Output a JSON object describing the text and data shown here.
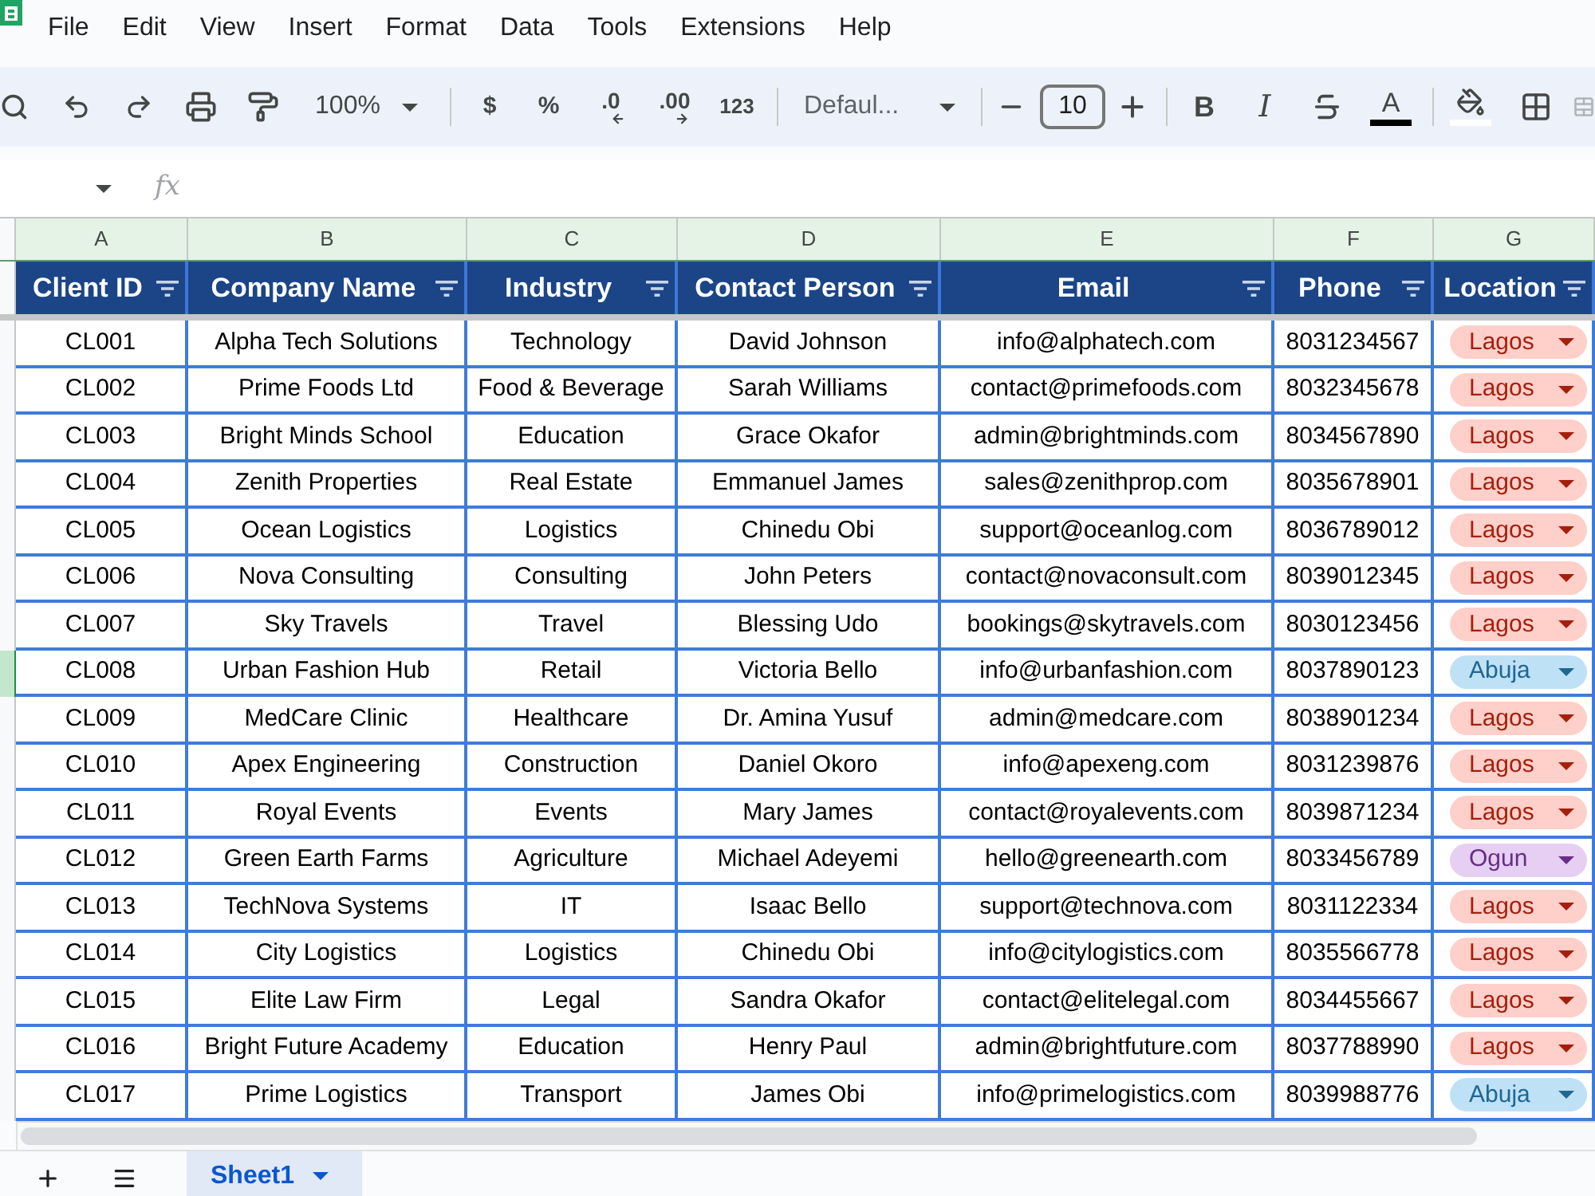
{
  "menu_bar": {
    "items": [
      "File",
      "Edit",
      "View",
      "Insert",
      "Format",
      "Data",
      "Tools",
      "Extensions",
      "Help"
    ]
  },
  "toolbar": {
    "zoom": "100%",
    "currency": "$",
    "percent": "%",
    "decrease_decimal": ".0",
    "increase_decimal": ".00",
    "number_format": "123",
    "font": "Defaul...",
    "font_size": "10",
    "bold": "B",
    "italic": "I",
    "text_color": "A"
  },
  "formula_bar": {
    "fx": "fx"
  },
  "sheet": {
    "column_letters": [
      "A",
      "B",
      "C",
      "D",
      "E",
      "F",
      "G"
    ],
    "headers": [
      "Client ID",
      "Company Name",
      "Industry",
      "Contact Person",
      "Email",
      "Phone",
      "Location"
    ],
    "rows": [
      {
        "selected": false,
        "cells": [
          "CL001",
          "Alpha Tech Solutions",
          "Technology",
          "David Johnson",
          "info@alphatech.com",
          "8031234567"
        ],
        "location": {
          "label": "Lagos",
          "color": "#ffcfc9"
        }
      },
      {
        "selected": false,
        "cells": [
          "CL002",
          "Prime Foods Ltd",
          "Food & Beverage",
          "Sarah Williams",
          "contact@primefoods.com",
          "8032345678"
        ],
        "location": {
          "label": "Lagos",
          "color": "#ffcfc9"
        }
      },
      {
        "selected": false,
        "cells": [
          "CL003",
          "Bright Minds School",
          "Education",
          "Grace Okafor",
          "admin@brightminds.com",
          "8034567890"
        ],
        "location": {
          "label": "Lagos",
          "color": "#ffcfc9"
        }
      },
      {
        "selected": false,
        "cells": [
          "CL004",
          "Zenith Properties",
          "Real Estate",
          "Emmanuel James",
          "sales@zenithprop.com",
          "8035678901"
        ],
        "location": {
          "label": "Lagos",
          "color": "#ffcfc9"
        }
      },
      {
        "selected": false,
        "cells": [
          "CL005",
          "Ocean Logistics",
          "Logistics",
          "Chinedu Obi",
          "support@oceanlog.com",
          "8036789012"
        ],
        "location": {
          "label": "Lagos",
          "color": "#ffcfc9"
        }
      },
      {
        "selected": false,
        "cells": [
          "CL006",
          "Nova Consulting",
          "Consulting",
          "John Peters",
          "contact@novaconsult.com",
          "8039012345"
        ],
        "location": {
          "label": "Lagos",
          "color": "#ffcfc9"
        }
      },
      {
        "selected": false,
        "cells": [
          "CL007",
          "Sky Travels",
          "Travel",
          "Blessing Udo",
          "bookings@skytravels.com",
          "8030123456"
        ],
        "location": {
          "label": "Lagos",
          "color": "#ffcfc9"
        }
      },
      {
        "selected": true,
        "cells": [
          "CL008",
          "Urban Fashion Hub",
          "Retail",
          "Victoria Bello",
          "info@urbanfashion.com",
          "8037890123"
        ],
        "location": {
          "label": "Abuja",
          "color": "#bfe1f6"
        }
      },
      {
        "selected": false,
        "cells": [
          "CL009",
          "MedCare Clinic",
          "Healthcare",
          "Dr. Amina Yusuf",
          "admin@medcare.com",
          "8038901234"
        ],
        "location": {
          "label": "Lagos",
          "color": "#ffcfc9"
        }
      },
      {
        "selected": false,
        "cells": [
          "CL010",
          "Apex Engineering",
          "Construction",
          "Daniel Okoro",
          "info@apexeng.com",
          "8031239876"
        ],
        "location": {
          "label": "Lagos",
          "color": "#ffcfc9"
        }
      },
      {
        "selected": false,
        "cells": [
          "CL011",
          "Royal Events",
          "Events",
          "Mary James",
          "contact@royalevents.com",
          "8039871234"
        ],
        "location": {
          "label": "Lagos",
          "color": "#ffcfc9"
        }
      },
      {
        "selected": false,
        "cells": [
          "CL012",
          "Green Earth Farms",
          "Agriculture",
          "Michael Adeyemi",
          "hello@greenearth.com",
          "8033456789"
        ],
        "location": {
          "label": "Ogun",
          "color": "#e6cff2"
        }
      },
      {
        "selected": false,
        "cells": [
          "CL013",
          "TechNova Systems",
          "IT",
          "Isaac Bello",
          "support@technova.com",
          "8031122334"
        ],
        "location": {
          "label": "Lagos",
          "color": "#ffcfc9"
        }
      },
      {
        "selected": false,
        "cells": [
          "CL014",
          "City Logistics",
          "Logistics",
          "Chinedu Obi",
          "info@citylogistics.com",
          "8035566778"
        ],
        "location": {
          "label": "Lagos",
          "color": "#ffcfc9"
        }
      },
      {
        "selected": false,
        "cells": [
          "CL015",
          "Elite Law Firm",
          "Legal",
          "Sandra Okafor",
          "contact@elitelegal.com",
          "8034455667"
        ],
        "location": {
          "label": "Lagos",
          "color": "#ffcfc9"
        }
      },
      {
        "selected": false,
        "cells": [
          "CL016",
          "Bright Future Academy",
          "Education",
          "Henry Paul",
          "admin@brightfuture.com",
          "8037788990"
        ],
        "location": {
          "label": "Lagos",
          "color": "#ffcfc9"
        }
      },
      {
        "selected": false,
        "cells": [
          "CL017",
          "Prime Logistics",
          "Transport",
          "James Obi",
          "info@primelogistics.com",
          "8039988776"
        ],
        "location": {
          "label": "Abuja",
          "color": "#bfe1f6"
        }
      }
    ]
  },
  "sheet_tabs": [
    {
      "label": "Sheet1",
      "selected": true
    }
  ]
}
